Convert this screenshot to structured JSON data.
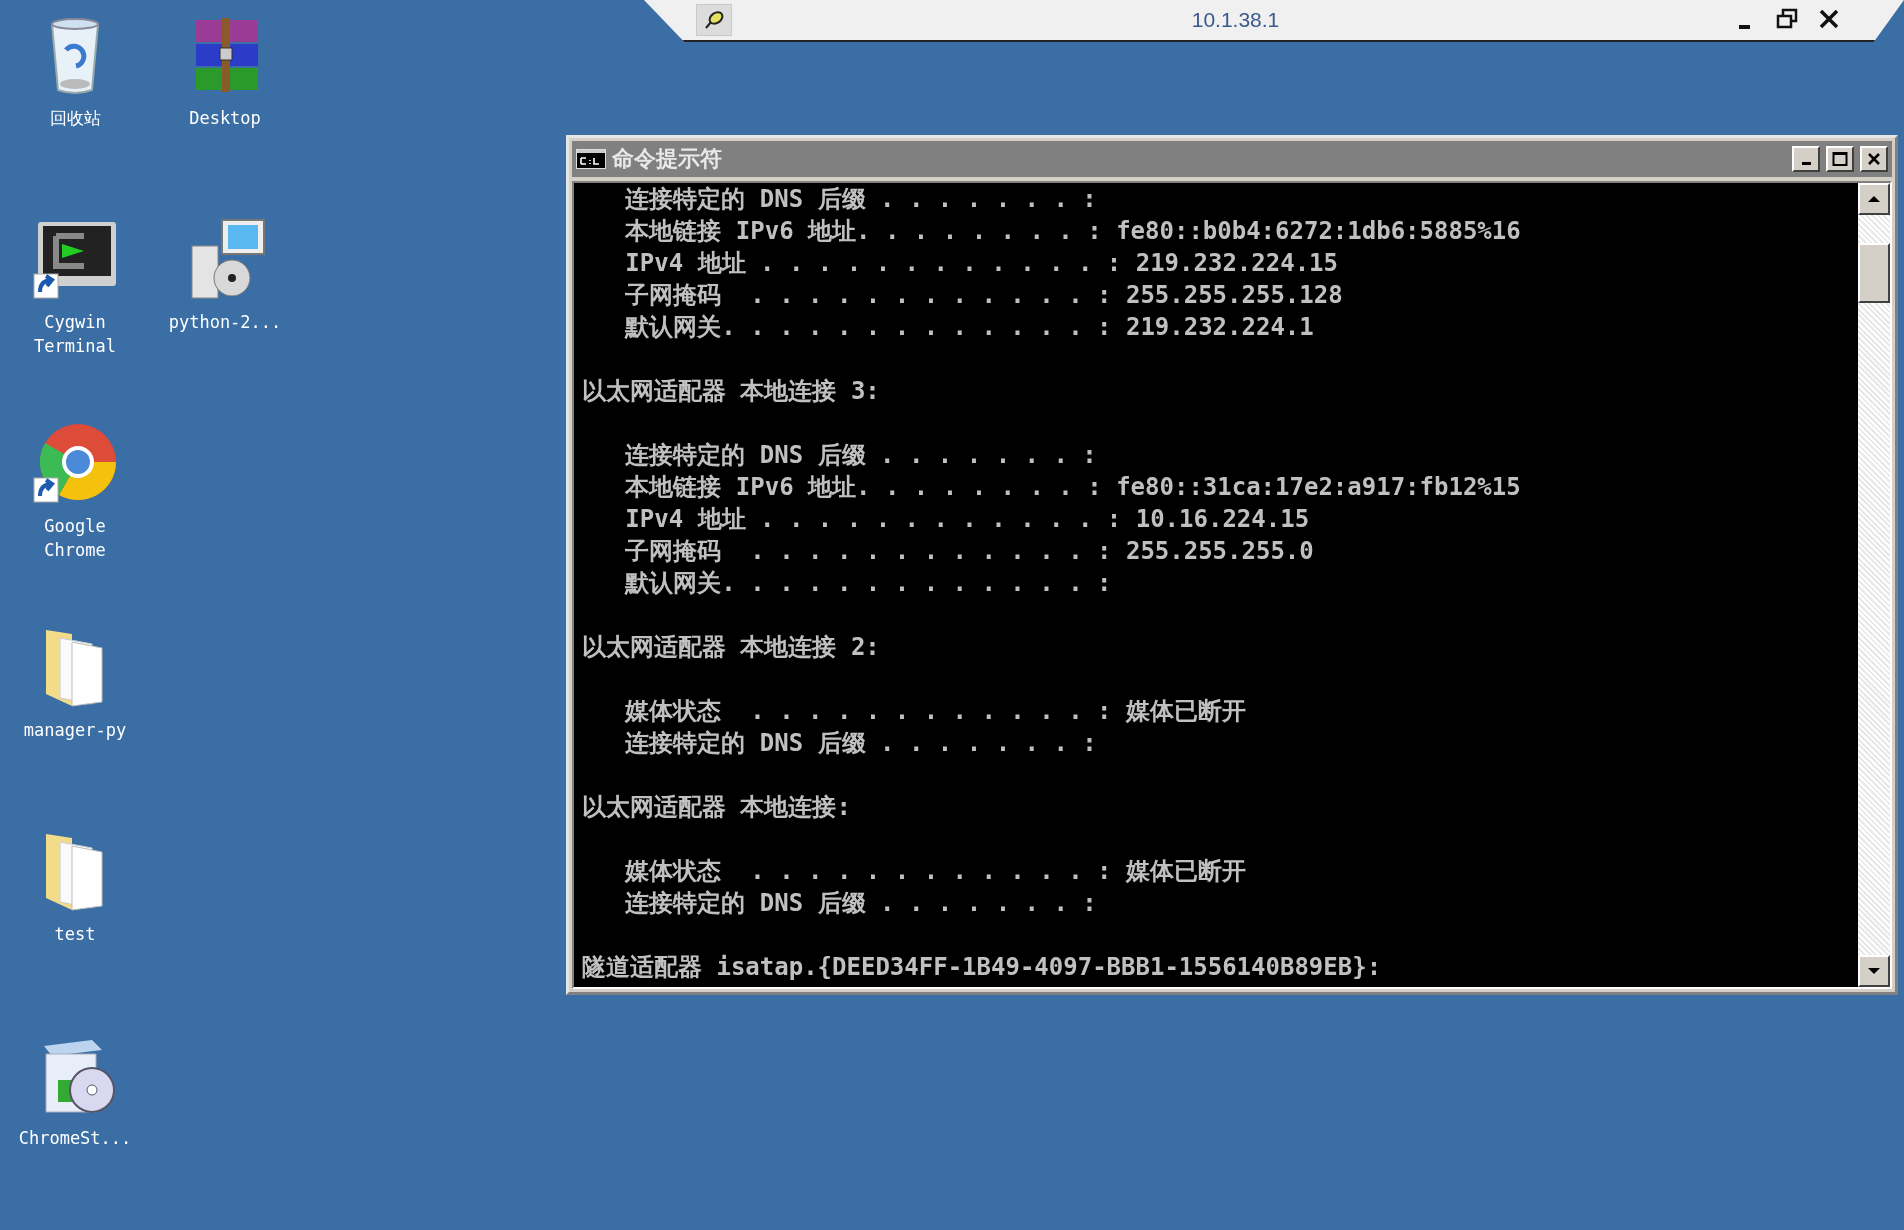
{
  "remote_bar": {
    "title": "10.1.38.1"
  },
  "desktop_icons": [
    {
      "label": "回收站",
      "kind": "recycle-bin"
    },
    {
      "label": "Cygwin Terminal",
      "kind": "terminal-shortcut"
    },
    {
      "label": "Google Chrome",
      "kind": "browser-shortcut"
    },
    {
      "label": "manager-py",
      "kind": "folder"
    },
    {
      "label": "test",
      "kind": "folder"
    },
    {
      "label": "ChromeSt...",
      "kind": "setup"
    },
    {
      "label": "Desktop",
      "kind": "archive"
    },
    {
      "label": "python-2...",
      "kind": "installer"
    }
  ],
  "console_window": {
    "title": "命令提示符",
    "blocks": [
      {
        "lines": [
          "   连接特定的 DNS 后缀 . . . . . . . :",
          "   本地链接 IPv6 地址. . . . . . . . : fe80::b0b4:6272:1db6:5885%16",
          "   IPv4 地址 . . . . . . . . . . . . : 219.232.224.15",
          "   子网掩码  . . . . . . . . . . . . : 255.255.255.128",
          "   默认网关. . . . . . . . . . . . . : 219.232.224.1"
        ]
      },
      {
        "heading": "以太网适配器 本地连接 3:",
        "lines": [
          "   连接特定的 DNS 后缀 . . . . . . . :",
          "   本地链接 IPv6 地址. . . . . . . . : fe80::31ca:17e2:a917:fb12%15",
          "   IPv4 地址 . . . . . . . . . . . . : 10.16.224.15",
          "   子网掩码  . . . . . . . . . . . . : 255.255.255.0",
          "   默认网关. . . . . . . . . . . . . :"
        ]
      },
      {
        "heading": "以太网适配器 本地连接 2:",
        "lines": [
          "   媒体状态  . . . . . . . . . . . . : 媒体已断开",
          "   连接特定的 DNS 后缀 . . . . . . . :"
        ]
      },
      {
        "heading": "以太网适配器 本地连接:",
        "lines": [
          "   媒体状态  . . . . . . . . . . . . : 媒体已断开",
          "   连接特定的 DNS 后缀 . . . . . . . :"
        ]
      },
      {
        "heading": "隧道适配器 isatap.{DEED34FF-1B49-4097-BBB1-1556140B89EB}:"
      }
    ]
  }
}
